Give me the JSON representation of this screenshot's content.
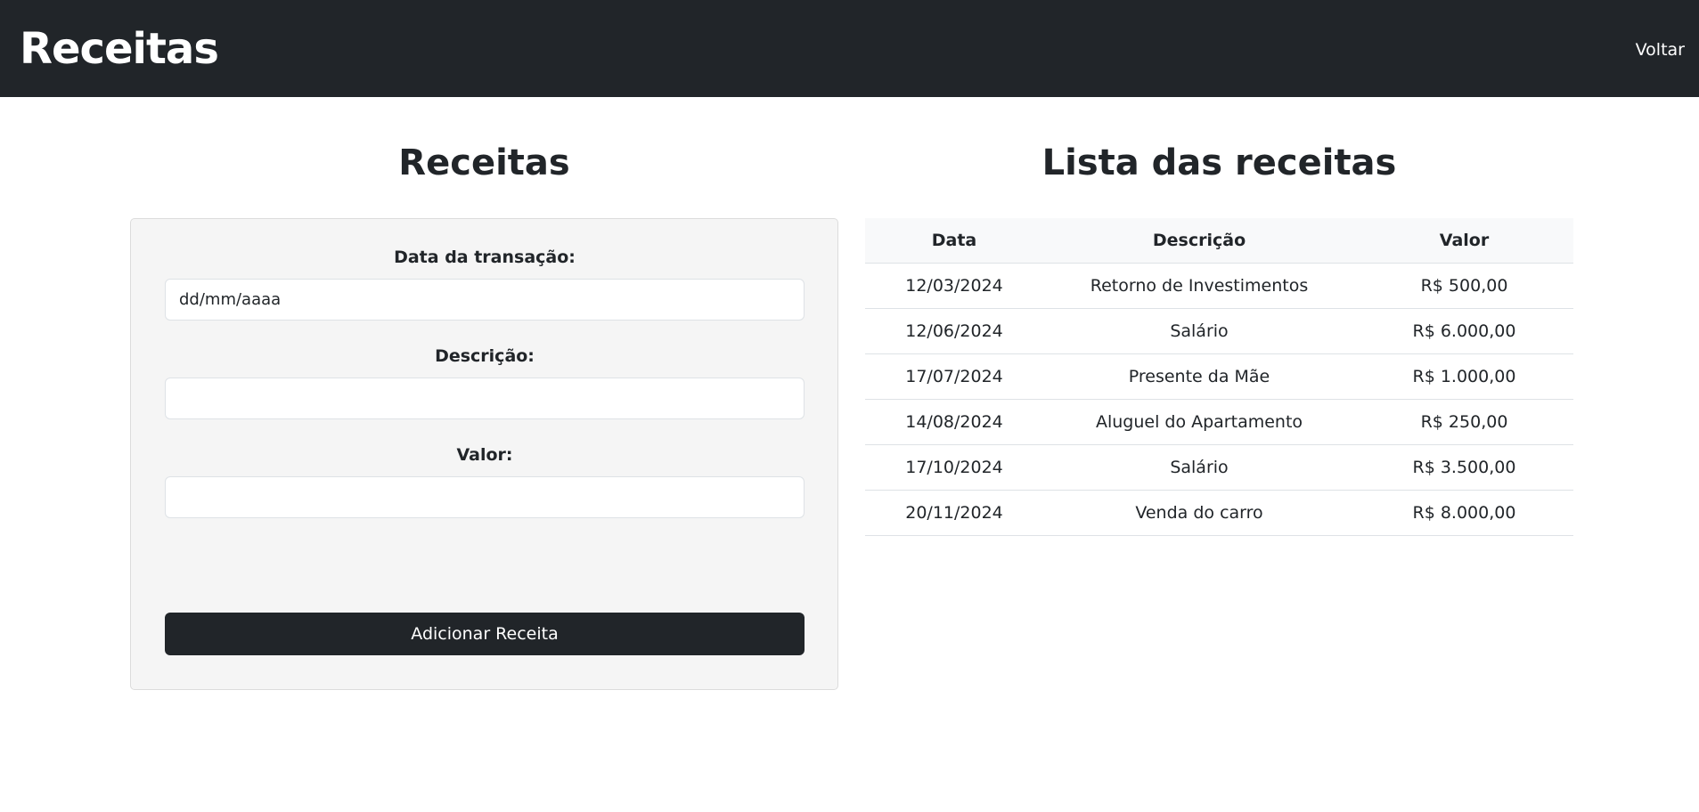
{
  "navbar": {
    "brand": "Receitas",
    "back_label": "Voltar"
  },
  "form_section": {
    "title": "Receitas",
    "date_label": "Data da transação:",
    "date_placeholder": "dd/mm/aaaa",
    "description_label": "Descrição:",
    "description_value": "",
    "value_label": "Valor:",
    "value_value": "",
    "submit_label": "Adicionar Receita"
  },
  "list_section": {
    "title": "Lista das receitas",
    "columns": [
      "Data",
      "Descrição",
      "Valor"
    ],
    "rows": [
      {
        "date": "12/03/2024",
        "description": "Retorno de Investimentos",
        "value": "R$ 500,00"
      },
      {
        "date": "12/06/2024",
        "description": "Salário",
        "value": "R$ 6.000,00"
      },
      {
        "date": "17/07/2024",
        "description": "Presente da Mãe",
        "value": "R$ 1.000,00"
      },
      {
        "date": "14/08/2024",
        "description": "Aluguel do Apartamento",
        "value": "R$ 250,00"
      },
      {
        "date": "17/10/2024",
        "description": "Salário",
        "value": "R$ 3.500,00"
      },
      {
        "date": "20/11/2024",
        "description": "Venda do carro",
        "value": "R$ 8.000,00"
      }
    ]
  },
  "colors": {
    "navbar_bg": "#212529",
    "card_bg": "#f5f5f5",
    "button_bg": "#212529",
    "table_header_bg": "#f8f9fa"
  }
}
